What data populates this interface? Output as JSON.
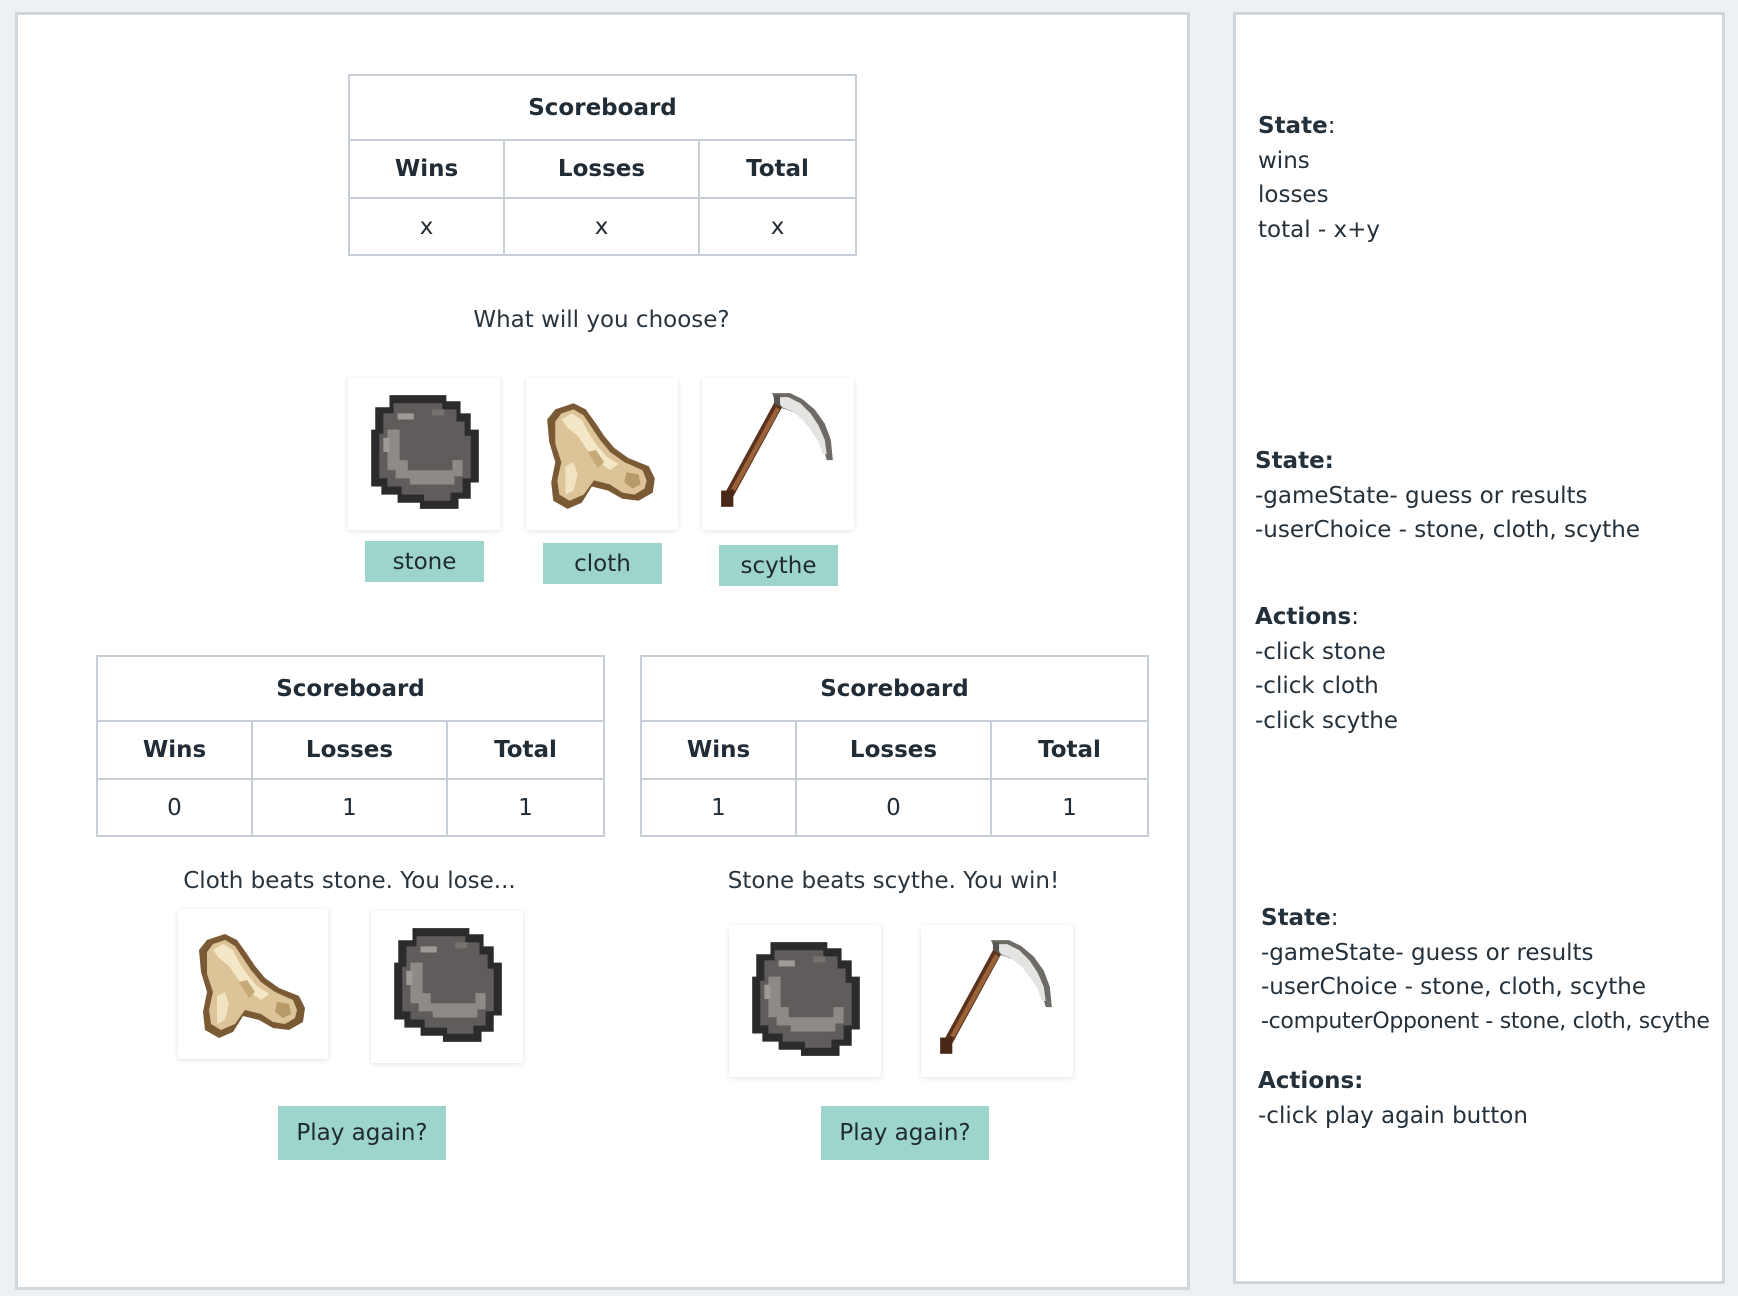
{
  "scoreboard_top": {
    "title": "Scoreboard",
    "headers": [
      "Wins",
      "Losses",
      "Total"
    ],
    "values": [
      "x",
      "x",
      "x"
    ]
  },
  "prompt": "What will you choose?",
  "choices": [
    {
      "label": "stone",
      "icon": "stone-icon"
    },
    {
      "label": "cloth",
      "icon": "cloth-icon"
    },
    {
      "label": "scythe",
      "icon": "scythe-icon"
    }
  ],
  "result_lose": {
    "scoreboard": {
      "title": "Scoreboard",
      "headers": [
        "Wins",
        "Losses",
        "Total"
      ],
      "values": [
        "0",
        "1",
        "1"
      ]
    },
    "message": "Cloth beats stone. You lose...",
    "user_icon": "cloth-icon",
    "computer_icon": "stone-icon",
    "play_again": "Play again?"
  },
  "result_win": {
    "scoreboard": {
      "title": "Scoreboard",
      "headers": [
        "Wins",
        "Losses",
        "Total"
      ],
      "values": [
        "1",
        "0",
        "1"
      ]
    },
    "message": "Stone beats scythe. You win!",
    "user_icon": "stone-icon",
    "computer_icon": "scythe-icon",
    "play_again": "Play again?"
  },
  "notes": {
    "block1": {
      "heading": "State",
      "suffix": ":",
      "lines": [
        "wins",
        "losses",
        "total - x+y"
      ]
    },
    "block2": {
      "heading": "State:",
      "lines": [
        "-gameState- guess or results",
        "-userChoice - stone, cloth, scythe"
      ]
    },
    "block3": {
      "heading": "Actions",
      "suffix": ":",
      "lines": [
        "-click stone",
        "-click cloth",
        "-click scythe"
      ]
    },
    "block4": {
      "heading": "State",
      "suffix": ":",
      "lines": [
        "-gameState- guess or results",
        "-userChoice - stone, cloth, scythe",
        "-computerOpponent - stone, cloth, scythe"
      ]
    },
    "block5": {
      "heading": "Actions:",
      "lines": [
        "-click play again button"
      ]
    }
  },
  "colors": {
    "button": "#9dd4cc",
    "table_border": "#c7ced5",
    "panel_border": "#cfd6dc",
    "background": "#eef1f4"
  }
}
